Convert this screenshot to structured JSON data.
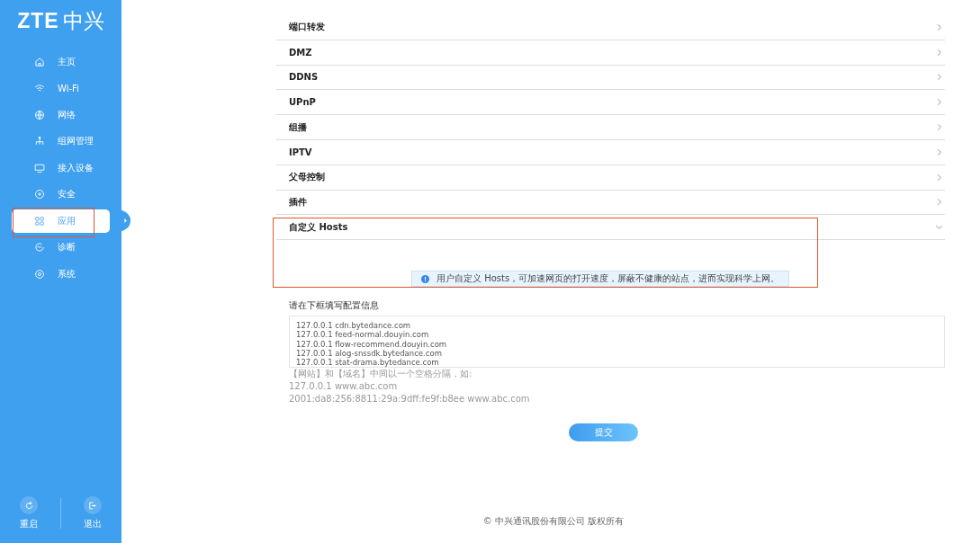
{
  "logo": {
    "brand": "ZTE",
    "name": "中兴"
  },
  "nav": [
    {
      "label": "主页",
      "selected": false,
      "highlighted": false
    },
    {
      "label": "Wi-Fi",
      "selected": false,
      "highlighted": false
    },
    {
      "label": "网络",
      "selected": false,
      "highlighted": false
    },
    {
      "label": "组网管理",
      "selected": false,
      "highlighted": false
    },
    {
      "label": "接入设备",
      "selected": false,
      "highlighted": false
    },
    {
      "label": "安全",
      "selected": false,
      "highlighted": false
    },
    {
      "label": "应用",
      "selected": true,
      "highlighted": true
    },
    {
      "label": "诊断",
      "selected": false,
      "highlighted": false
    },
    {
      "label": "系统",
      "selected": false,
      "highlighted": false
    }
  ],
  "bottom_actions": [
    {
      "label": "重启"
    },
    {
      "label": "退出"
    }
  ],
  "sections": [
    {
      "title": "端口转发",
      "expanded": false,
      "highlighted": false
    },
    {
      "title": "DMZ",
      "expanded": false,
      "highlighted": false
    },
    {
      "title": "DDNS",
      "expanded": false,
      "highlighted": false
    },
    {
      "title": "UPnP",
      "expanded": false,
      "highlighted": false
    },
    {
      "title": "组播",
      "expanded": false,
      "highlighted": false
    },
    {
      "title": "IPTV",
      "expanded": false,
      "highlighted": false
    },
    {
      "title": "父母控制",
      "expanded": false,
      "highlighted": false
    },
    {
      "title": "插件",
      "expanded": false,
      "highlighted": false
    },
    {
      "title": "自定义 Hosts",
      "expanded": true,
      "highlighted": true,
      "tip": "用户自定义 Hosts，可加速网页的打开速度，屏蔽不健康的站点，进而实现科学上网。"
    }
  ],
  "form": {
    "label": "请在下框填写配置信息",
    "hosts_lines": [
      "127.0.0.1 cdn.bytedance.com",
      "127.0.0.1 feed-normal.douyin.com",
      "127.0.0.1 flow-recommend.douyin.com",
      "127.0.0.1 alog-snssdk.bytedance.com",
      "127.0.0.1 stat-drama.bytedance.com"
    ],
    "hints": [
      "【网站】和【域名】中间以一个空格分隔，如:",
      "127.0.0.1 www.abc.com",
      "2001:da8:256:8811:29a:9dff:fe9f:b8ee www.abc.com"
    ],
    "submit": "提交"
  },
  "footer": "© 中兴通讯股份有限公司 版权所有"
}
